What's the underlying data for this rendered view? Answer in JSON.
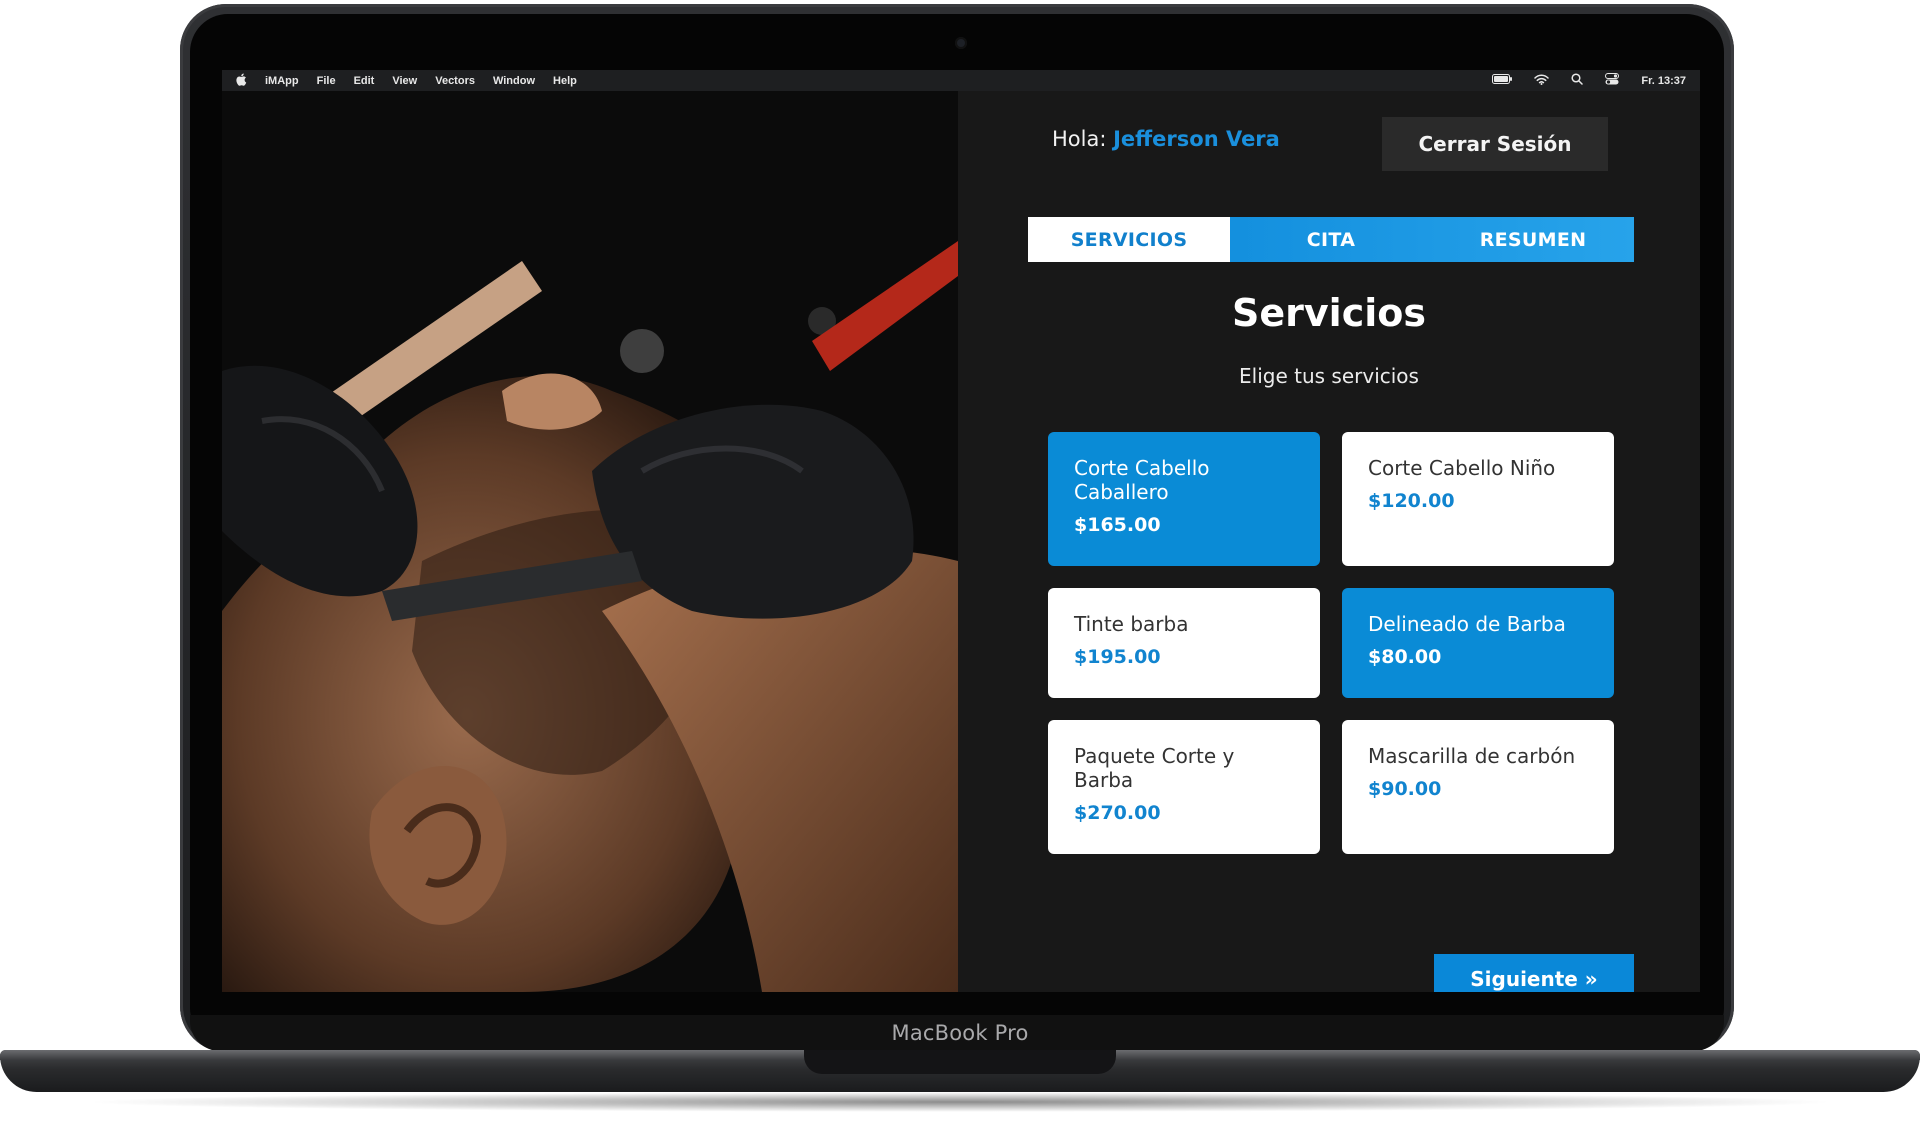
{
  "device": {
    "brand_label": "MacBook Pro"
  },
  "menubar": {
    "app_name": "iMApp",
    "items": [
      "File",
      "Edit",
      "View",
      "Vectors",
      "Window",
      "Help"
    ],
    "clock": "Fr. 13:37"
  },
  "header": {
    "greeting_prefix": "Hola:",
    "user_name": "Jefferson Vera",
    "logout_label": "Cerrar Sesión"
  },
  "tabs": [
    {
      "label": "SERVICIOS",
      "active": true
    },
    {
      "label": "CITA",
      "active": false
    },
    {
      "label": "RESUMEN",
      "active": false
    }
  ],
  "main": {
    "title": "Servicios",
    "subtitle": "Elige tus servicios"
  },
  "services": [
    {
      "name": "Corte Cabello Caballero",
      "price": "$165.00",
      "selected": true
    },
    {
      "name": "Corte Cabello Niño",
      "price": "$120.00",
      "selected": false
    },
    {
      "name": "Tinte barba",
      "price": "$195.00",
      "selected": false
    },
    {
      "name": "Delineado de Barba",
      "price": "$80.00",
      "selected": true
    },
    {
      "name": "Paquete Corte y Barba",
      "price": "$270.00",
      "selected": false
    },
    {
      "name": "Mascarilla de carbón",
      "price": "$90.00",
      "selected": false
    }
  ],
  "footer": {
    "next_label": "Siguiente »"
  },
  "colors": {
    "accent": "#0a8bd6",
    "panel_bg": "#181818",
    "card_bg": "#ffffff"
  }
}
